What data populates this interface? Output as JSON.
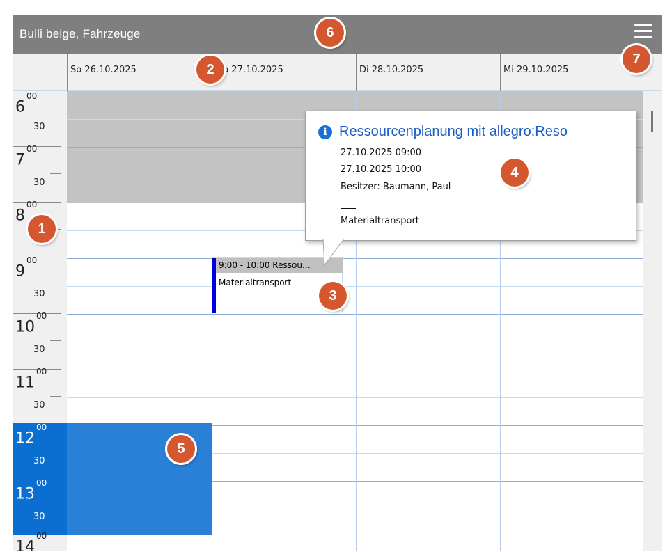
{
  "window": {
    "title": "Bulli beige, Fahrzeuge"
  },
  "menu": {
    "icon": "hamburger-menu-icon"
  },
  "days": [
    {
      "label": "So 26.10.2025"
    },
    {
      "label": "Mo 27.10.2025"
    },
    {
      "label": "Di 28.10.2025"
    },
    {
      "label": "Mi 29.10.2025"
    }
  ],
  "time_axis": {
    "hours": [
      "6",
      "7",
      "8",
      "9",
      "10",
      "11",
      "12",
      "13",
      "14"
    ],
    "minutes_full": "00",
    "minutes_half": "30"
  },
  "event": {
    "header": "9:00 - 10:00 Ressou…",
    "description": "Materialtransport",
    "accent_color": "#0000dd"
  },
  "tooltip": {
    "icon": "info-icon",
    "title": "Ressourcenplanung mit allegro:Reso",
    "start": "27.10.2025 09:00",
    "end": "27.10.2025 10:00",
    "owner": "Besitzer: Baumann, Paul",
    "description": "Materialtransport"
  },
  "badges": [
    "1",
    "2",
    "3",
    "4",
    "5",
    "6",
    "7"
  ],
  "colors": {
    "titlebar": "#7f7f7f",
    "selection": "#2a7fd6",
    "unavailable": "#c3c3c3",
    "badge": "#d4572f",
    "tooltip_title": "#1a5fc4"
  }
}
